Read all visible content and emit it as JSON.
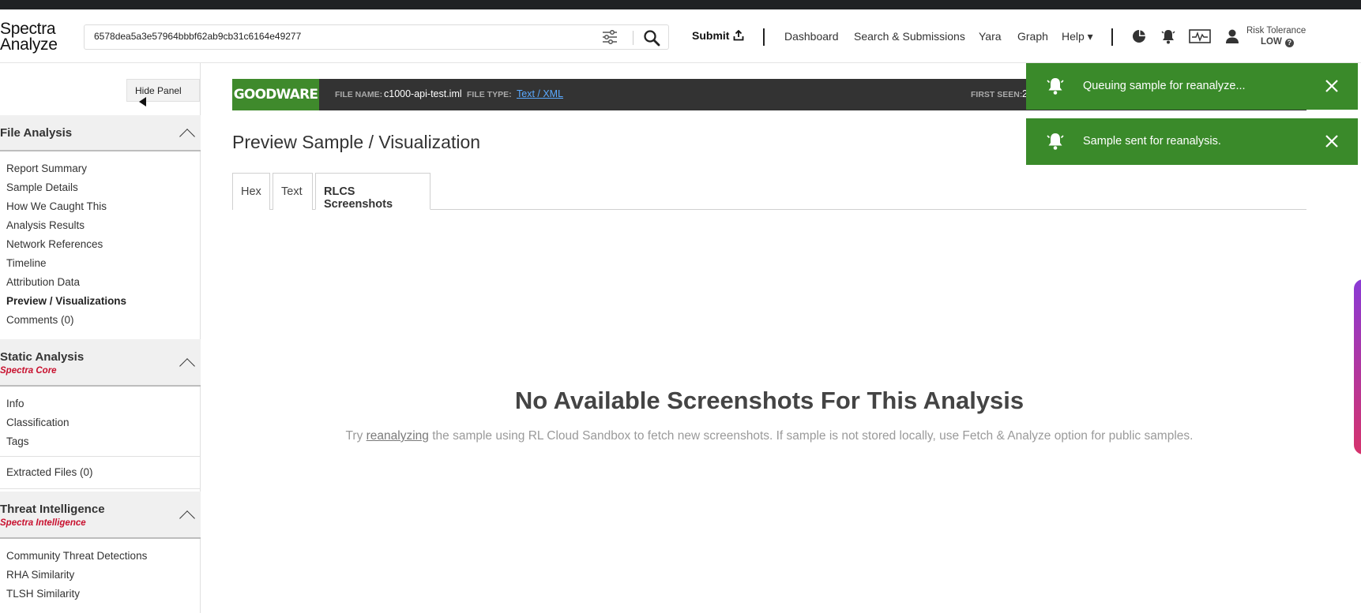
{
  "app": {
    "logo_line1": "Spectra",
    "logo_line2": "Analyze"
  },
  "search": {
    "value": "6578dea5a3e57964bbbf62ab9cb31c6164e49277",
    "filter_icon": "sliders-icon",
    "search_icon": "magnifier-icon"
  },
  "nav": {
    "submit_label": "Submit",
    "links": [
      "Dashboard",
      "Search & Submissions",
      "Yara",
      "Graph",
      "Help ▾"
    ],
    "icons": [
      "pie-chart-icon",
      "bell-icon",
      "activity-monitor-icon",
      "user-icon"
    ],
    "risk_label": "Risk Tolerance",
    "risk_value": "LOW",
    "risk_help": "?"
  },
  "sidebar": {
    "hide_panel_label": "Hide Panel",
    "file_analysis": {
      "title": "File Analysis",
      "items": [
        "Report Summary",
        "Sample Details",
        "How We Caught This",
        "Analysis Results",
        "Network References",
        "Timeline",
        "Attribution Data",
        "Preview / Visualizations",
        "Comments (0)"
      ],
      "active": "Preview / Visualizations"
    },
    "static_analysis": {
      "title": "Static Analysis",
      "subtitle": "Spectra Core",
      "items": [
        "Info",
        "Classification",
        "Tags"
      ]
    },
    "extracted_files": "Extracted Files (0)",
    "threat_intel": {
      "title": "Threat Intelligence",
      "subtitle": "Spectra Intelligence",
      "items": [
        "Community Threat Detections",
        "RHA Similarity",
        "TLSH Similarity"
      ]
    }
  },
  "banner": {
    "classification": "GOODWARE",
    "file_name_label": "FILE NAME:",
    "file_name": "c1000-api-test.iml",
    "file_type_label": "FILE TYPE:",
    "file_type": "Text / XML",
    "first_seen_label": "FIRST SEEN:",
    "first_seen_partial": "2"
  },
  "main": {
    "page_title": "Preview Sample / Visualization",
    "tabs": [
      "Hex",
      "Text",
      "RLCS Screenshots"
    ],
    "active_tab": "RLCS Screenshots",
    "empty_title": "No Available Screenshots For This Analysis",
    "empty_desc_pre": "Try ",
    "empty_desc_link": "reanalyzing",
    "empty_desc_post": " the sample using RL Cloud Sandbox to fetch new screenshots. If sample is not stored locally, use Fetch & Analyze option for public samples."
  },
  "toasts": [
    {
      "message": "Queuing sample for reanalyze..."
    },
    {
      "message": "Sample sent for reanalysis."
    }
  ],
  "colors": {
    "goodware_green": "#3f8a2c",
    "toast_green": "#3a8a2a",
    "banner_dark": "#333333",
    "subtitle_red": "#c8102e",
    "link_blue": "#5aa9ff"
  }
}
